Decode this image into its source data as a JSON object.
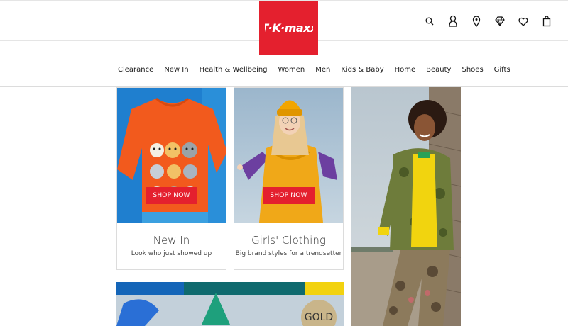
{
  "brand": {
    "logo_text": "TK MAXX",
    "color": "#e4202e"
  },
  "header": {
    "icons": [
      "search-icon",
      "account-icon",
      "store-locator-icon",
      "gold-diamond-icon",
      "wishlist-icon",
      "bag-icon"
    ]
  },
  "nav": {
    "items": [
      "Clearance",
      "New In",
      "Health & Wellbeing",
      "Women",
      "Men",
      "Kids & Baby",
      "Home",
      "Beauty",
      "Shoes",
      "Gifts"
    ]
  },
  "cards": [
    {
      "title": "New In",
      "subtitle": "Look who just showed up",
      "button": "SHOP NOW"
    },
    {
      "title": "Girls' Clothing",
      "subtitle": "Big brand styles for a trendsetter",
      "button": "SHOP NOW"
    }
  ],
  "banner": {
    "badge": "GOLD"
  }
}
